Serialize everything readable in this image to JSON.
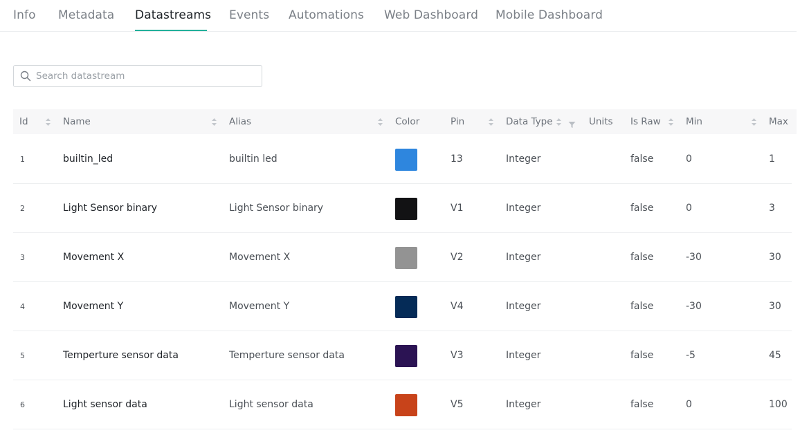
{
  "tabs": [
    {
      "label": "Info"
    },
    {
      "label": "Metadata"
    },
    {
      "label": "Datastreams"
    },
    {
      "label": "Events"
    },
    {
      "label": "Automations"
    },
    {
      "label": "Web Dashboard"
    },
    {
      "label": "Mobile Dashboard"
    }
  ],
  "active_tab": "Datastreams",
  "accent_color": "#23b09b",
  "search": {
    "placeholder": "Search datastream",
    "value": ""
  },
  "columns": {
    "id": "Id",
    "name": "Name",
    "alias": "Alias",
    "color": "Color",
    "pin": "Pin",
    "data_type": "Data Type",
    "units": "Units",
    "is_raw": "Is Raw",
    "min": "Min",
    "max": "Max"
  },
  "rows": [
    {
      "id": "1",
      "name": "builtin_led",
      "alias": "builtin led",
      "color": "#2e86de",
      "pin": "13",
      "data_type": "Integer",
      "units": "",
      "is_raw": "false",
      "min": "0",
      "max": "1"
    },
    {
      "id": "2",
      "name": "Light Sensor binary",
      "alias": "Light Sensor binary",
      "color": "#121214",
      "pin": "V1",
      "data_type": "Integer",
      "units": "",
      "is_raw": "false",
      "min": "0",
      "max": "3"
    },
    {
      "id": "3",
      "name": "Movement X",
      "alias": "Movement X",
      "color": "#939393",
      "pin": "V2",
      "data_type": "Integer",
      "units": "",
      "is_raw": "false",
      "min": "-30",
      "max": "30"
    },
    {
      "id": "4",
      "name": "Movement Y",
      "alias": "Movement Y",
      "color": "#052b57",
      "pin": "V4",
      "data_type": "Integer",
      "units": "",
      "is_raw": "false",
      "min": "-30",
      "max": "30"
    },
    {
      "id": "5",
      "name": "Temperture sensor data",
      "alias": "Temperture sensor data",
      "color": "#2b1353",
      "pin": "V3",
      "data_type": "Integer",
      "units": "",
      "is_raw": "false",
      "min": "-5",
      "max": "45"
    },
    {
      "id": "6",
      "name": "Light sensor data",
      "alias": "Light sensor data",
      "color": "#c8431a",
      "pin": "V5",
      "data_type": "Integer",
      "units": "",
      "is_raw": "false",
      "min": "0",
      "max": "100"
    }
  ]
}
